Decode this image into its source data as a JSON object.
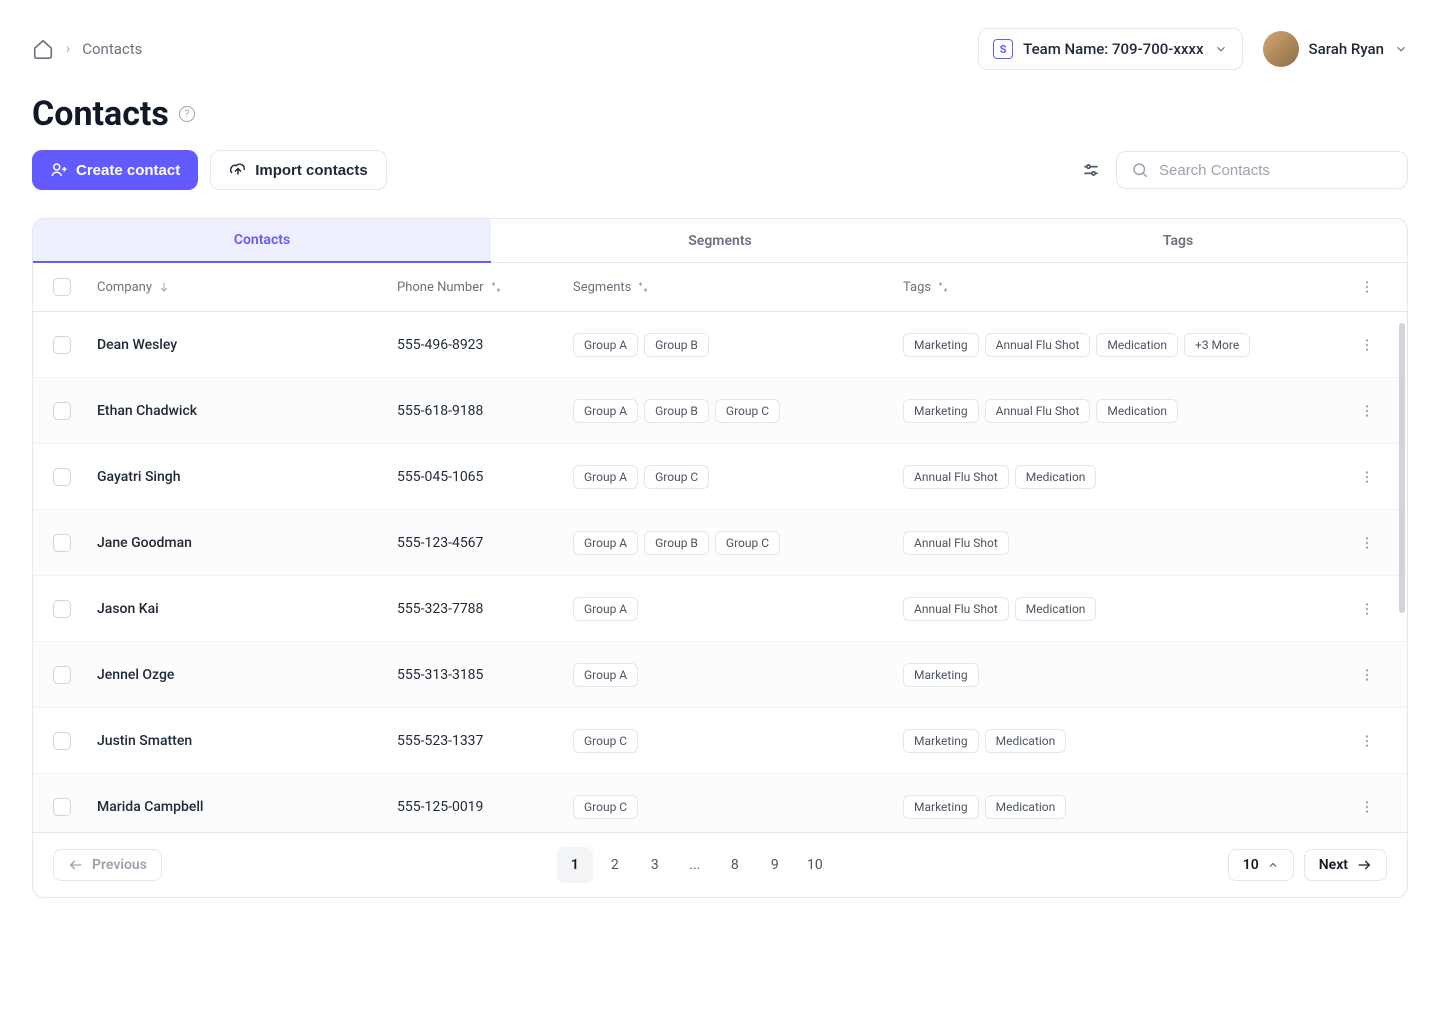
{
  "breadcrumb": {
    "current": "Contacts"
  },
  "team": {
    "label": "Team Name: 709-700-xxxx",
    "logo": "S"
  },
  "user": {
    "name": "Sarah Ryan"
  },
  "page": {
    "title": "Contacts"
  },
  "actions": {
    "create": "Create contact",
    "import": "Import contacts"
  },
  "search": {
    "placeholder": "Search Contacts"
  },
  "tabs": [
    {
      "label": "Contacts",
      "active": true
    },
    {
      "label": "Segments",
      "active": false
    },
    {
      "label": "Tags",
      "active": false
    }
  ],
  "columns": {
    "company": "Company",
    "phone": "Phone Number",
    "segments": "Segments",
    "tags": "Tags"
  },
  "rows": [
    {
      "name": "Dean Wesley",
      "phone": "555-496-8923",
      "segments": [
        "Group A",
        "Group B"
      ],
      "tags": [
        "Marketing",
        "Annual Flu Shot",
        "Medication",
        "+3 More"
      ]
    },
    {
      "name": "Ethan Chadwick",
      "phone": "555-618-9188",
      "segments": [
        "Group A",
        "Group B",
        "Group C"
      ],
      "tags": [
        "Marketing",
        "Annual Flu Shot",
        "Medication"
      ]
    },
    {
      "name": "Gayatri Singh",
      "phone": "555-045-1065",
      "segments": [
        "Group A",
        "Group C"
      ],
      "tags": [
        "Annual Flu Shot",
        "Medication"
      ]
    },
    {
      "name": "Jane Goodman",
      "phone": "555-123-4567",
      "segments": [
        "Group A",
        "Group B",
        "Group C"
      ],
      "tags": [
        "Annual Flu Shot"
      ]
    },
    {
      "name": "Jason Kai",
      "phone": "555-323-7788",
      "segments": [
        "Group A"
      ],
      "tags": [
        "Annual Flu Shot",
        "Medication"
      ]
    },
    {
      "name": "Jennel Ozge",
      "phone": "555-313-3185",
      "segments": [
        "Group A"
      ],
      "tags": [
        "Marketing"
      ]
    },
    {
      "name": "Justin Smatten",
      "phone": "555-523-1337",
      "segments": [
        "Group C"
      ],
      "tags": [
        "Marketing",
        "Medication"
      ]
    },
    {
      "name": "Marida Campbell",
      "phone": "555-125-0019",
      "segments": [
        "Group C"
      ],
      "tags": [
        "Marketing",
        "Medication"
      ]
    }
  ],
  "pagination": {
    "previous": "Previous",
    "next": "Next",
    "pages": [
      "1",
      "2",
      "3",
      "...",
      "8",
      "9",
      "10"
    ],
    "active_page": "1",
    "page_size": "10"
  }
}
